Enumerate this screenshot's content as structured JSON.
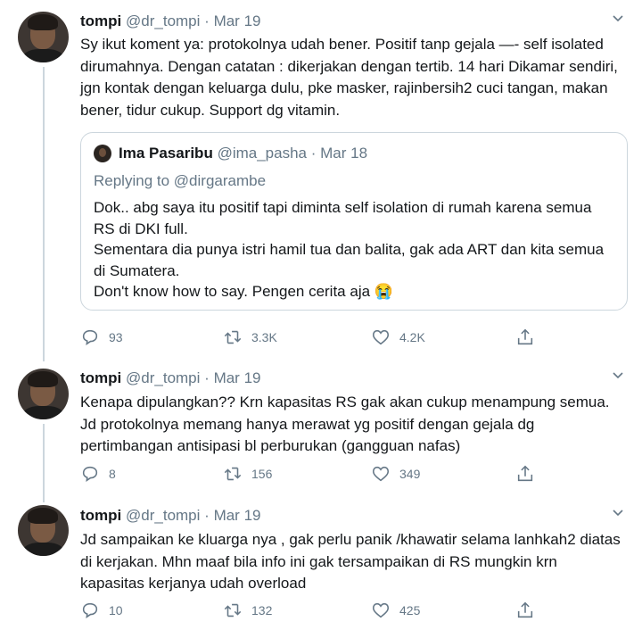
{
  "tweets": [
    {
      "name": "tompi",
      "handle": "@dr_tompi",
      "dot": "·",
      "date": "Mar 19",
      "text": "Sy ikut koment ya: protokolnya udah bener. Positif tanp gejala —- self isolated dirumahnya. Dengan catatan : dikerjakan dengan tertib. 14 hari Dikamar sendiri, jgn kontak dengan keluarga dulu, pke masker, rajinbersih2 cuci tangan, makan bener, tidur cukup. Support dg vitamin.",
      "quote": {
        "name": "Ima Pasaribu",
        "handle": "@ima_pasha",
        "dot": "·",
        "date": "Mar 18",
        "replying_prefix": "Replying to",
        "replying_to": "@dirgarambe",
        "text": "Dok.. abg saya itu positif tapi diminta self isolation di rumah karena semua RS di DKI full.\nSementara dia punya istri hamil tua dan balita, gak ada ART dan kita semua di Sumatera.\nDon't know how to say. Pengen cerita aja 😭"
      },
      "replies": "93",
      "retweets": "3.3K",
      "likes": "4.2K"
    },
    {
      "name": "tompi",
      "handle": "@dr_tompi",
      "dot": "·",
      "date": "Mar 19",
      "text": "Kenapa dipulangkan?? Krn kapasitas RS gak akan cukup menampung semua. Jd protokolnya memang hanya merawat yg positif dengan gejala dg pertimbangan antisipasi bl perburukan (gangguan nafas)",
      "replies": "8",
      "retweets": "156",
      "likes": "349"
    },
    {
      "name": "tompi",
      "handle": "@dr_tompi",
      "dot": "·",
      "date": "Mar 19",
      "text": "Jd sampaikan ke kluarga nya , gak perlu panik /khawatir selama lanhkah2 diatas di kerjakan. Mhn maaf bila info ini gak tersampaikan di RS mungkin krn kapasitas kerjanya udah overload",
      "replies": "10",
      "retweets": "132",
      "likes": "425"
    }
  ],
  "icons": {
    "reply": "reply-icon",
    "retweet": "retweet-icon",
    "like": "heart-icon",
    "share": "share-icon",
    "more": "chevron-down-icon"
  },
  "colors": {
    "secondary_text": "#657786",
    "border": "#ccd6dd",
    "primary_text": "#14171a"
  }
}
